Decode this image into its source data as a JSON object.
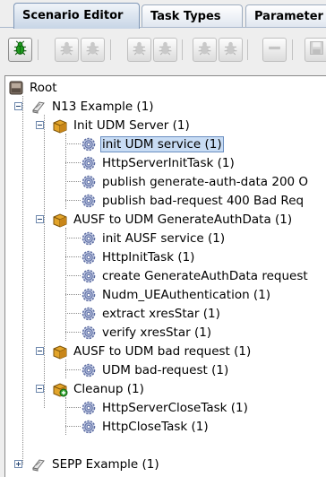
{
  "tabs": [
    {
      "label": "Scenario Editor",
      "active": true
    },
    {
      "label": "Task Types",
      "active": false
    },
    {
      "label": "Parameter",
      "active": false
    }
  ],
  "toolbar": {
    "buttons": [
      {
        "icon": "bug-icon",
        "enabled": true
      },
      {
        "icon": "bug-icon",
        "enabled": false
      },
      {
        "icon": "bug-icon",
        "enabled": false
      },
      {
        "icon": "bug-icon",
        "enabled": false
      },
      {
        "icon": "bug-icon",
        "enabled": false
      },
      {
        "icon": "bug-icon",
        "enabled": false
      },
      {
        "icon": "bug-icon",
        "enabled": false
      },
      {
        "icon": "minus-icon",
        "enabled": false
      },
      {
        "icon": "save-icon",
        "enabled": false
      }
    ]
  },
  "tree": {
    "root": "Root",
    "nodes": [
      {
        "label": "N13 Example (1)",
        "icon": "scenario-icon"
      },
      {
        "label": "Init UDM Server (1)",
        "icon": "package-icon"
      },
      {
        "label": "init UDM service (1)",
        "icon": "gear-icon",
        "selected": true
      },
      {
        "label": "HttpServerInitTask (1)",
        "icon": "gear-icon"
      },
      {
        "label": "publish generate-auth-data 200 O",
        "icon": "gear-icon"
      },
      {
        "label": "publish bad-request 400 Bad Req",
        "icon": "gear-icon"
      },
      {
        "label": "AUSF to UDM GenerateAuthData (1)",
        "icon": "package-icon"
      },
      {
        "label": "init AUSF service (1)",
        "icon": "gear-icon"
      },
      {
        "label": "HttpInitTask (1)",
        "icon": "gear-icon"
      },
      {
        "label": "create GenerateAuthData request",
        "icon": "gear-icon"
      },
      {
        "label": "Nudm_UEAuthentication (1)",
        "icon": "gear-icon"
      },
      {
        "label": "extract xresStar (1)",
        "icon": "gear-icon"
      },
      {
        "label": "verify xresStar (1)",
        "icon": "gear-icon"
      },
      {
        "label": "AUSF to UDM bad request (1)",
        "icon": "package-icon"
      },
      {
        "label": "UDM bad-request (1)",
        "icon": "gear-icon"
      },
      {
        "label": "Cleanup (1)",
        "icon": "package-plus-icon"
      },
      {
        "label": "HttpServerCloseTask (1)",
        "icon": "gear-icon"
      },
      {
        "label": "HttpCloseTask (1)",
        "icon": "gear-icon"
      },
      {
        "label": "SEPP Example (1)",
        "icon": "scenario-icon"
      }
    ]
  }
}
